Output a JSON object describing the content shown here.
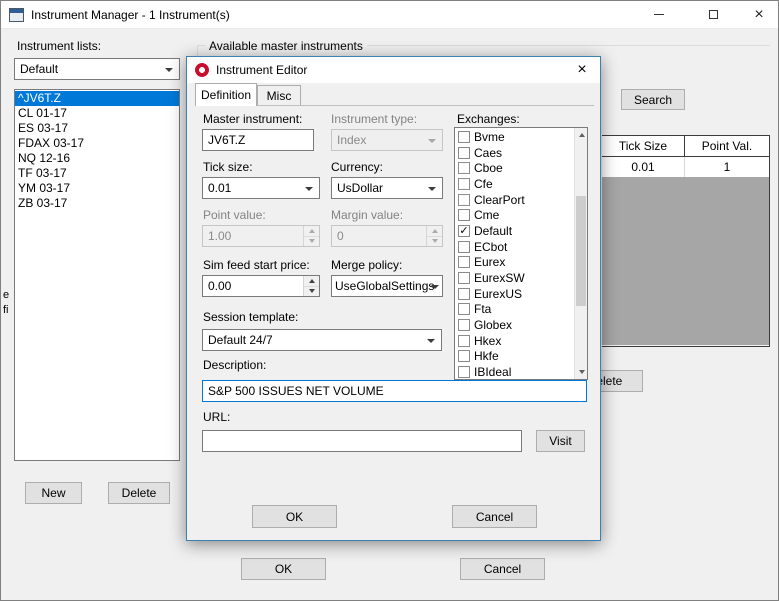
{
  "window": {
    "title": "Instrument Manager - 1 Instrument(s)"
  },
  "icons": {
    "close": "×",
    "checkmark": "✓",
    "minimize": "horizontal-bar-shape",
    "maximize": "square-outline-shape",
    "chevron_down": "css-triangle-down",
    "app": "window-grid-icon",
    "ninjatrader": "red-ring-logo",
    "scroll_up": "css-triangle-up",
    "scroll_down": "css-triangle-down"
  },
  "colors": {
    "selection": "#0078d7",
    "focus_border": "#0078d7",
    "dialog_border": "#3c7fb1",
    "table_empty": "#a6a6a6",
    "titlebar": "#ffffff",
    "window_bg": "#f0f0f0"
  },
  "left_panel": {
    "label": "Instrument lists:",
    "list_dropdown_value": "Default",
    "instruments": [
      "^JV6T.Z",
      "CL 01-17",
      "ES 03-17",
      "FDAX 03-17",
      "NQ 12-16",
      "TF 03-17",
      "YM 03-17",
      "ZB 03-17"
    ],
    "selected_instrument": "^JV6T.Z",
    "new_button": "New",
    "delete_button": "Delete"
  },
  "right_panel": {
    "group_label": "Available master instruments",
    "search_button": "Search",
    "table": {
      "columns": [
        "Tick Size",
        "Point Val."
      ],
      "rows": [
        [
          "0.01",
          "1"
        ]
      ]
    },
    "delete_button": "Delete"
  },
  "main_buttons": {
    "ok": "OK",
    "cancel": "Cancel"
  },
  "edge_fragments": [
    "e",
    "fi"
  ],
  "dialog": {
    "title": "Instrument Editor",
    "tabs": [
      "Definition",
      "Misc"
    ],
    "active_tab": "Definition",
    "fields": {
      "master_instrument": {
        "label": "Master instrument:",
        "value": "JV6T.Z"
      },
      "instrument_type": {
        "label": "Instrument type:",
        "value": "Index",
        "disabled": true
      },
      "tick_size": {
        "label": "Tick size:",
        "value": "0.01"
      },
      "currency": {
        "label": "Currency:",
        "value": "UsDollar"
      },
      "point_value": {
        "label": "Point value:",
        "value": "1.00",
        "disabled": true
      },
      "margin_value": {
        "label": "Margin value:",
        "value": "0",
        "disabled": true
      },
      "sim_feed_start_price": {
        "label": "Sim feed start price:",
        "value": "0.00"
      },
      "merge_policy": {
        "label": "Merge policy:",
        "value": "UseGlobalSettings"
      },
      "session_template": {
        "label": "Session template:",
        "value": "Default 24/7"
      },
      "description": {
        "label": "Description:",
        "value": "S&P 500 ISSUES NET VOLUME"
      },
      "url": {
        "label": "URL:",
        "value": ""
      }
    },
    "exchanges": {
      "label": "Exchanges:",
      "items": [
        {
          "name": "Bvme",
          "checked": false
        },
        {
          "name": "Caes",
          "checked": false
        },
        {
          "name": "Cboe",
          "checked": false
        },
        {
          "name": "Cfe",
          "checked": false
        },
        {
          "name": "ClearPort",
          "checked": false
        },
        {
          "name": "Cme",
          "checked": false
        },
        {
          "name": "Default",
          "checked": true
        },
        {
          "name": "ECbot",
          "checked": false
        },
        {
          "name": "Eurex",
          "checked": false
        },
        {
          "name": "EurexSW",
          "checked": false
        },
        {
          "name": "EurexUS",
          "checked": false
        },
        {
          "name": "Fta",
          "checked": false
        },
        {
          "name": "Globex",
          "checked": false
        },
        {
          "name": "Hkex",
          "checked": false
        },
        {
          "name": "Hkfe",
          "checked": false
        },
        {
          "name": "IBIdeal",
          "checked": false
        }
      ]
    },
    "buttons": {
      "ok": "OK",
      "cancel": "Cancel",
      "visit": "Visit"
    }
  }
}
